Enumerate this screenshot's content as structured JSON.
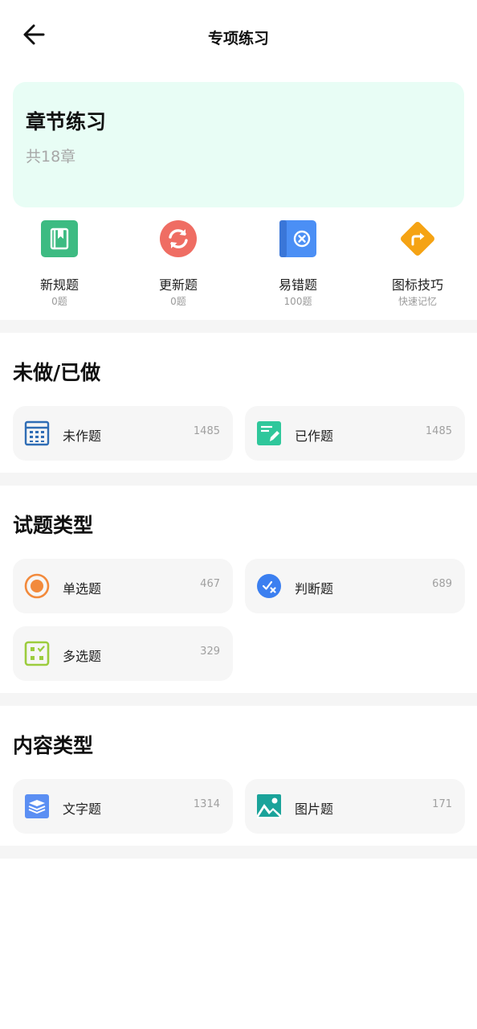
{
  "header": {
    "title": "专项练习"
  },
  "chapter": {
    "title": "章节练习",
    "subtitle": "共18章"
  },
  "quick_items": [
    {
      "label": "新规题",
      "sub": "0题",
      "icon": "bookmark-book-icon",
      "color": "#3dbb82"
    },
    {
      "label": "更新题",
      "sub": "0题",
      "icon": "refresh-icon",
      "color": "#ef6d63"
    },
    {
      "label": "易错题",
      "sub": "100题",
      "icon": "error-book-icon",
      "color": "#4b8ff5"
    },
    {
      "label": "图标技巧",
      "sub": "快速记忆",
      "icon": "turn-sign-icon",
      "color": "#f5a314"
    }
  ],
  "sections": [
    {
      "title": "未做/已做",
      "tiles": [
        {
          "label": "未作题",
          "count": "1485",
          "icon": "grid-list-icon"
        },
        {
          "label": "已作题",
          "count": "1485",
          "icon": "edit-note-icon"
        }
      ]
    },
    {
      "title": "试题类型",
      "tiles": [
        {
          "label": "单选题",
          "count": "467",
          "icon": "radio-icon"
        },
        {
          "label": "判断题",
          "count": "689",
          "icon": "judge-icon"
        },
        {
          "label": "多选题",
          "count": "329",
          "icon": "checkbox-grid-icon"
        }
      ]
    },
    {
      "title": "内容类型",
      "tiles": [
        {
          "label": "文字题",
          "count": "1314",
          "icon": "text-book-icon"
        },
        {
          "label": "图片题",
          "count": "171",
          "icon": "picture-icon"
        }
      ]
    }
  ]
}
